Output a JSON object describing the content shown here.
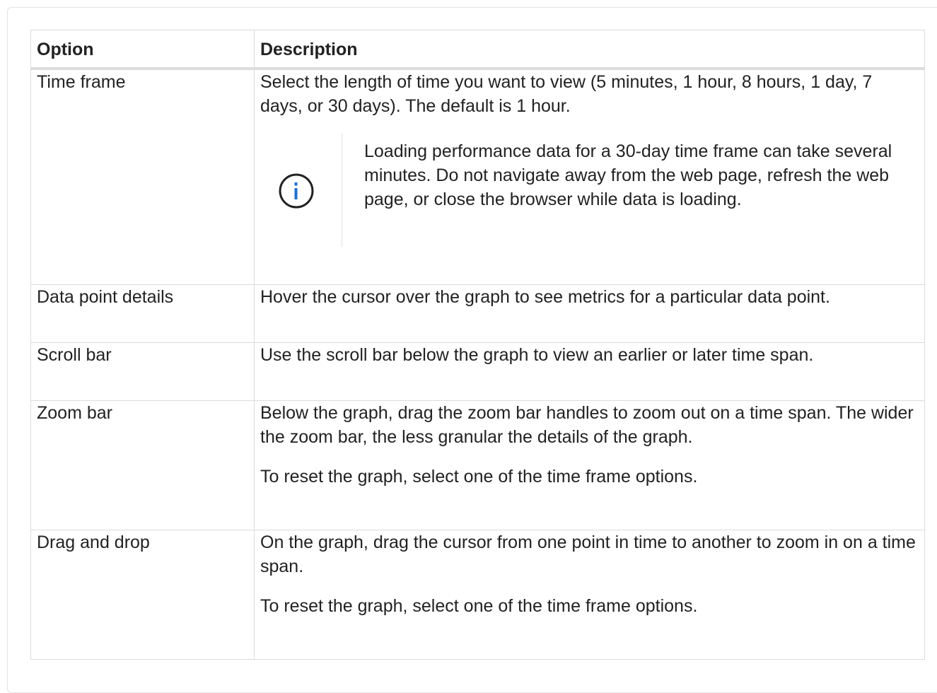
{
  "table": {
    "headers": {
      "option": "Option",
      "description": "Description"
    },
    "rows": [
      {
        "option": "Time frame",
        "description": "Select the length of time you want to view (5 minutes, 1 hour, 8 hours, 1 day, 7 days, or 30 days). The default is 1 hour.",
        "note": {
          "icon": "info-icon",
          "text": "Loading performance data for a 30-day time frame can take several minutes. Do not navigate away from the web page, refresh the web page, or close the browser while data is loading."
        }
      },
      {
        "option": "Data point details",
        "description": "Hover the cursor over the graph to see metrics for a particular data point."
      },
      {
        "option": "Scroll bar",
        "description": "Use the scroll bar below the graph to view an earlier or later time span."
      },
      {
        "option": "Zoom bar",
        "description": "Below the graph, drag the zoom bar handles to zoom out on a time span. The wider the zoom bar, the less granular the details of the graph.",
        "description_extra": "To reset the graph, select one of the time frame options."
      },
      {
        "option": "Drag and drop",
        "description": "On the graph, drag the cursor from one point in time to another to zoom in on a time span.",
        "description_extra": "To reset the graph, select one of the time frame options."
      }
    ]
  },
  "colors": {
    "info_icon": "#1f6fcf",
    "info_ring": "#222222",
    "border": "#dcdcdc"
  }
}
